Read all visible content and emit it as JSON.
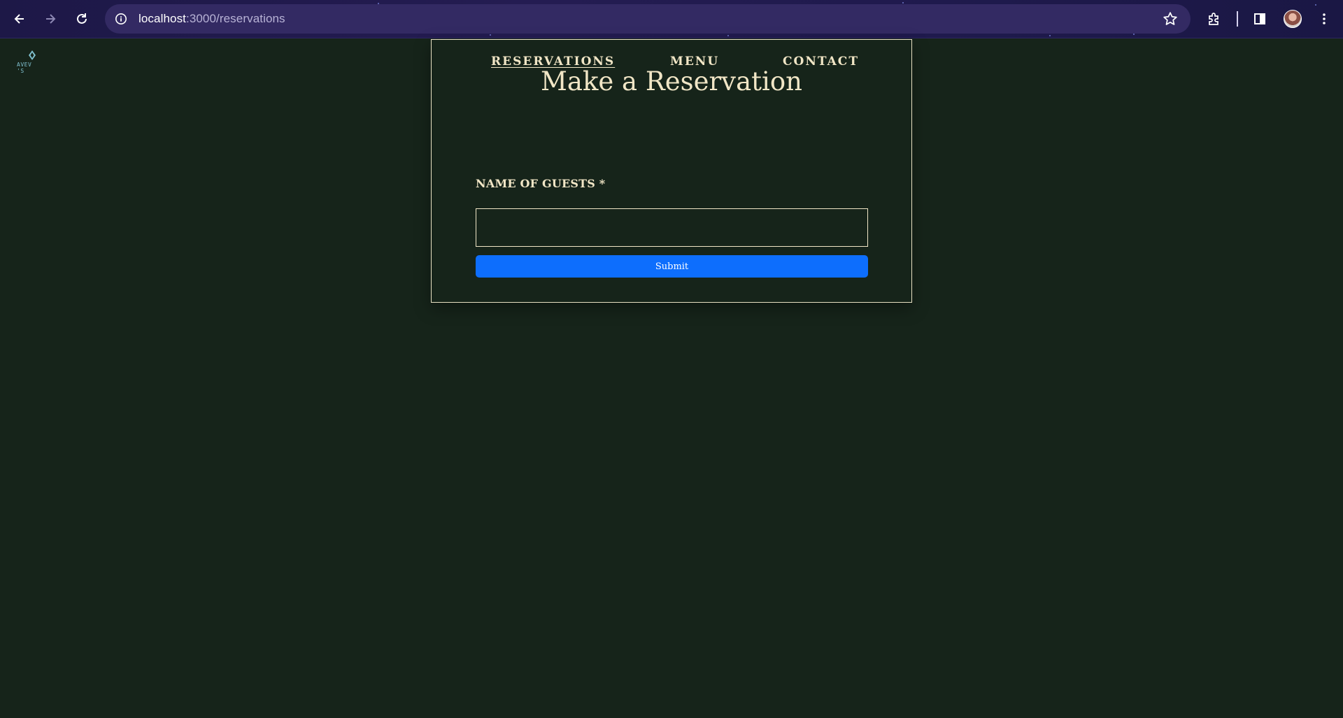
{
  "browser": {
    "url_host": "localhost",
    "url_path": ":3000/reservations",
    "icons": [
      "back-arrow-icon",
      "forward-arrow-icon",
      "reload-icon",
      "site-info-icon",
      "bookmark-star-icon",
      "extensions-icon",
      "side-panel-icon",
      "profile-avatar",
      "more-options-icon"
    ]
  },
  "logo": {
    "text": "AVEV 'S"
  },
  "nav": {
    "reservations": "RESERVATIONS",
    "menu": "MENU",
    "contact": "CONTACT",
    "active": "reservations"
  },
  "page": {
    "title": "Make a Reservation"
  },
  "form": {
    "name_label": "NAME OF GUESTS *",
    "name_value": "",
    "submit_label": "Submit"
  },
  "colors": {
    "background": "#16241a",
    "text": "#f1e6c6",
    "button": "#0d6efd",
    "chrome": "#241c52"
  }
}
